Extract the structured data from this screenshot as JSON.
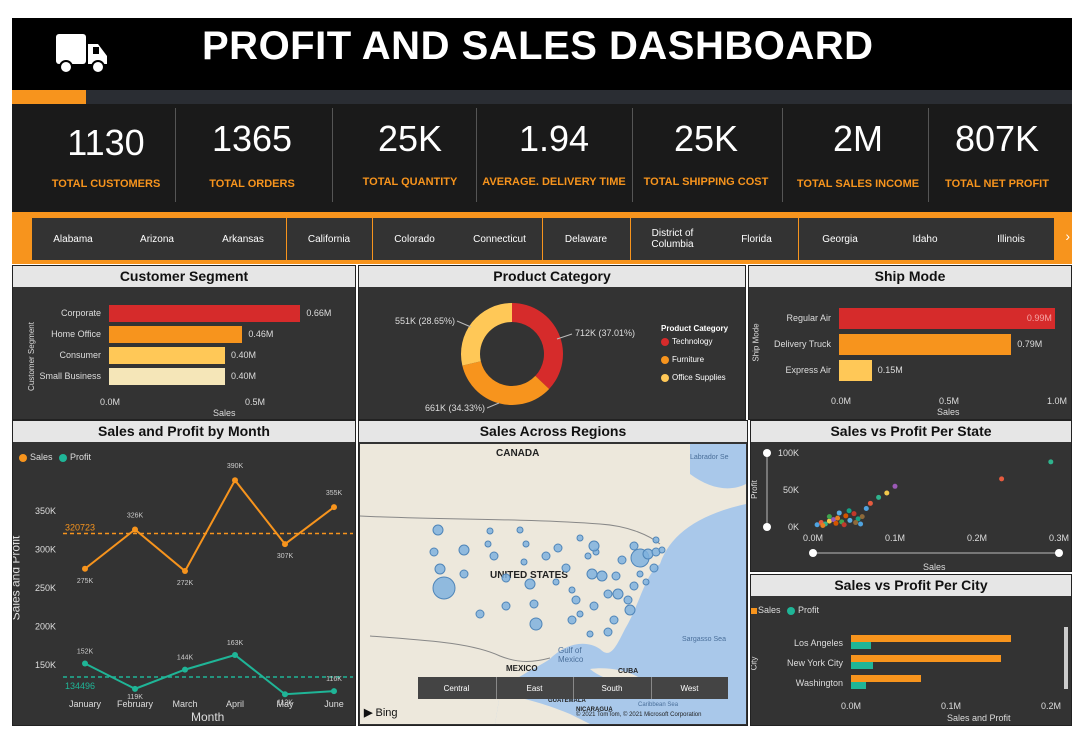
{
  "header": {
    "title": "PROFIT AND SALES DASHBOARD",
    "logo_icon": "truck-icon"
  },
  "kpis": [
    {
      "value": "1130",
      "label": "TOTAL CUSTOMERS"
    },
    {
      "value": "1365",
      "label": "TOTAL ORDERS"
    },
    {
      "value": "25K",
      "label": "TOTAL QUANTITY"
    },
    {
      "value": "1.94",
      "label": "AVERAGE. DELIVERY TIME"
    },
    {
      "value": "25K",
      "label": "TOTAL SHIPPING COST"
    },
    {
      "value": "2M",
      "label": "TOTAL SALES INCOME"
    },
    {
      "value": "807K",
      "label": "TOTAL NET PROFIT"
    }
  ],
  "states": [
    "Alabama",
    "Arizona",
    "Arkansas",
    "California",
    "Colorado",
    "Connecticut",
    "Delaware",
    "District of Columbia",
    "Florida",
    "Georgia",
    "Idaho",
    "Illinois"
  ],
  "colors": {
    "orange": "#f7941d",
    "red": "#d62b2b",
    "yellow": "#ffc857",
    "cream": "#f5e6b8",
    "teal": "#1fb597",
    "panel": "#333333"
  },
  "segment": {
    "title": "Customer Segment",
    "axis_title": "Customer Segment",
    "x_label": "Sales",
    "ticks": [
      "0.0M",
      "0.5M"
    ],
    "chart_data": {
      "type": "bar",
      "categories": [
        "Corporate",
        "Home Office",
        "Consumer",
        "Small Business"
      ],
      "values": [
        0.66,
        0.46,
        0.4,
        0.4
      ],
      "labels": [
        "0.66M",
        "0.46M",
        "0.40M",
        "0.40M"
      ]
    }
  },
  "category": {
    "title": "Product Category",
    "legend_title": "Product Category",
    "chart_data": {
      "type": "pie",
      "categories": [
        "Technology",
        "Furniture",
        "Office Supplies"
      ],
      "values": [
        37.01,
        34.33,
        28.65
      ],
      "labels": [
        "712K (37.01%)",
        "661K (34.33%)",
        "551K (28.65%)"
      ]
    }
  },
  "shipmode": {
    "title": "Ship Mode",
    "axis_title": "Ship Mode",
    "x_label": "Sales",
    "ticks": [
      "0.0M",
      "0.5M",
      "1.0M"
    ],
    "chart_data": {
      "type": "bar",
      "categories": [
        "Regular Air",
        "Delivery Truck",
        "Express Air"
      ],
      "values": [
        0.99,
        0.79,
        0.15
      ],
      "labels": [
        "0.99M",
        "0.79M",
        "0.15M"
      ],
      "xlim": [
        0,
        1.0
      ]
    }
  },
  "monthly": {
    "title": "Sales and Profit by Month",
    "legend": [
      "Sales",
      "Profit"
    ],
    "ylabel": "Sales and Profit",
    "xlabel": "Month",
    "y_ticks": [
      "350K",
      "300K",
      "250K",
      "200K",
      "150K"
    ],
    "avg_sales_label": "320723",
    "avg_profit_label": "134496",
    "chart_data": {
      "type": "line",
      "categories": [
        "January",
        "February",
        "March",
        "April",
        "May",
        "June"
      ],
      "series": [
        {
          "name": "Sales",
          "values": [
            275,
            326,
            272,
            390,
            307,
            355
          ],
          "labels": [
            "275K",
            "326K",
            "272K",
            "390K",
            "307K",
            "355K"
          ]
        },
        {
          "name": "Profit",
          "values": [
            152,
            119,
            144,
            163,
            112,
            116
          ],
          "labels": [
            "152K",
            "119K",
            "144K",
            "163K",
            "112K",
            "116K"
          ]
        }
      ],
      "avg_lines": [
        320.723,
        134.496
      ],
      "ylim": [
        105,
        405
      ]
    }
  },
  "regions": {
    "title": "Sales Across Regions",
    "labels": {
      "canada": "CANADA",
      "us": "UNITED STATES",
      "mexico": "MEXICO",
      "cuba": "CUBA",
      "gulf": "Gulf of Mexico",
      "sargasso": "Sargasso Sea",
      "labrador": "Labrador Se",
      "caribbean": "Caribbean Sea",
      "guatemala": "GUATEMALA",
      "nicaragua": "NICARAGUA"
    },
    "tabs": [
      "Central",
      "East",
      "South",
      "West"
    ],
    "bing": "Bing",
    "copyright": "© 2021 TomTom, © 2021 Microsoft Corporation"
  },
  "state_scatter": {
    "title": "Sales vs Profit Per State",
    "ylabel": "Profit",
    "xlabel": "Sales",
    "y_ticks": [
      "100K",
      "50K",
      "0K"
    ],
    "x_ticks": [
      "0.0M",
      "0.1M",
      "0.2M",
      "0.3M"
    ],
    "chart_data": {
      "type": "scatter",
      "points": [
        [
          0.005,
          3
        ],
        [
          0.01,
          6
        ],
        [
          0.015,
          4
        ],
        [
          0.02,
          8
        ],
        [
          0.025,
          10
        ],
        [
          0.03,
          12
        ],
        [
          0.035,
          7
        ],
        [
          0.04,
          15
        ],
        [
          0.045,
          9
        ],
        [
          0.05,
          18
        ],
        [
          0.055,
          11
        ],
        [
          0.06,
          14
        ],
        [
          0.065,
          25
        ],
        [
          0.07,
          32
        ],
        [
          0.08,
          40
        ],
        [
          0.09,
          46
        ],
        [
          0.1,
          55
        ],
        [
          0.012,
          2
        ],
        [
          0.02,
          14
        ],
        [
          0.028,
          5
        ],
        [
          0.032,
          19
        ],
        [
          0.038,
          3
        ],
        [
          0.044,
          22
        ],
        [
          0.052,
          6
        ],
        [
          0.058,
          4
        ],
        [
          0.23,
          65
        ],
        [
          0.29,
          88
        ]
      ],
      "xlim": [
        0,
        0.3
      ],
      "ylim": [
        0,
        100
      ]
    }
  },
  "city": {
    "title": "Sales vs Profit Per City",
    "legend": [
      "Sales",
      "Profit"
    ],
    "ylabel": "City",
    "xlabel": "Sales and Profit",
    "x_ticks": [
      "0.0M",
      "0.1M",
      "0.2M"
    ],
    "chart_data": {
      "type": "bar",
      "categories": [
        "Los Angeles",
        "New York City",
        "Washington"
      ],
      "series": [
        {
          "name": "Sales",
          "values": [
            0.16,
            0.15,
            0.07
          ]
        },
        {
          "name": "Profit",
          "values": [
            0.02,
            0.022,
            0.015
          ]
        }
      ],
      "xlim": [
        0,
        0.2
      ]
    }
  }
}
